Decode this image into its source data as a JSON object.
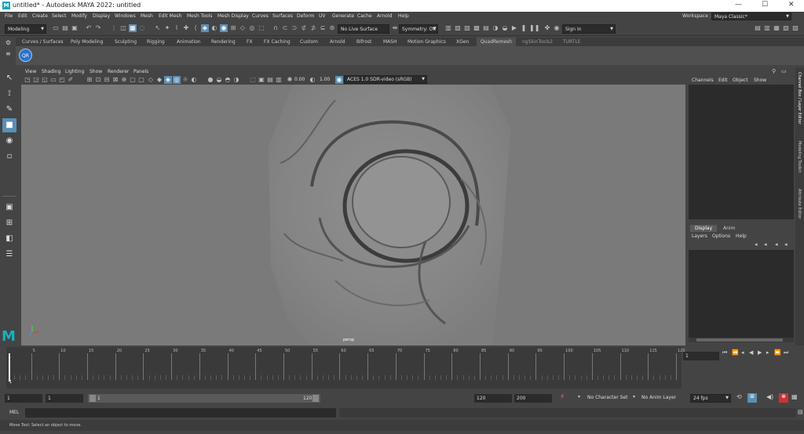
{
  "window": {
    "logo_letter": "M",
    "title": "untitled* - Autodesk MAYA 2022: untitled",
    "minimize": "—",
    "maximize": "☐",
    "close": "✕"
  },
  "menu": [
    "File",
    "Edit",
    "Create",
    "Select",
    "Modify",
    "Display",
    "Windows",
    "Mesh",
    "Edit Mesh",
    "Mesh Tools",
    "Mesh Display",
    "Curves",
    "Surfaces",
    "Deform",
    "UV",
    "Generate",
    "Cache",
    "Arnold",
    "Help"
  ],
  "workspace": {
    "label": "Workspace :",
    "value": "Maya Classic*"
  },
  "toolbar": {
    "mode": "Modeling",
    "live_surface": "No Live Surface",
    "symmetry": "Symmetry: Off",
    "sign_in": "Sign In"
  },
  "shelf_tabs": [
    "Curves / Surfaces",
    "Poly Modeling",
    "Sculpting",
    "Rigging",
    "Animation",
    "Rendering",
    "FX",
    "FX Caching",
    "Custom",
    "Arnold",
    "Bifrost",
    "MASH",
    "Motion Graphics",
    "XGen",
    "QuadRemesh",
    "ngSkinTools2",
    "TURTLE"
  ],
  "shelf_active": "QuadRemesh",
  "shelf_button": "QR",
  "viewport_menu": [
    "View",
    "Shading",
    "Lighting",
    "Show",
    "Renderer",
    "Panels"
  ],
  "viewport": {
    "exposure": "0.00",
    "gamma": "1.00",
    "color_space": "ACES 1.0 SDR-video (sRGB)",
    "camera": "persp"
  },
  "channel_box": {
    "menu": [
      "Channels",
      "Edit",
      "Object",
      "Show"
    ],
    "layer_tabs": [
      "Display",
      "Anim"
    ],
    "layer_menu": [
      "Layers",
      "Options",
      "Help"
    ]
  },
  "side_tabs": [
    "Channel Box / Layer Editor",
    "Modeling Toolkit",
    "Attribute Editor"
  ],
  "timeline": {
    "ticks": [
      1,
      5,
      10,
      15,
      20,
      25,
      30,
      35,
      40,
      45,
      50,
      55,
      60,
      65,
      70,
      75,
      80,
      85,
      90,
      95,
      100,
      105,
      110,
      115,
      120
    ],
    "start": 1,
    "end": 120,
    "current_frame": "1",
    "current_marker": "1"
  },
  "range": {
    "start_field": "1",
    "playback_start": "1",
    "slider_start": "1",
    "slider_end": "120",
    "playback_end": "120",
    "anim_end": "200",
    "character_set": "No Character Set",
    "anim_layer": "No Anim Layer",
    "fps": "24 fps"
  },
  "mel": {
    "label": "MEL"
  },
  "status": "Move Tool: Select an object to move."
}
